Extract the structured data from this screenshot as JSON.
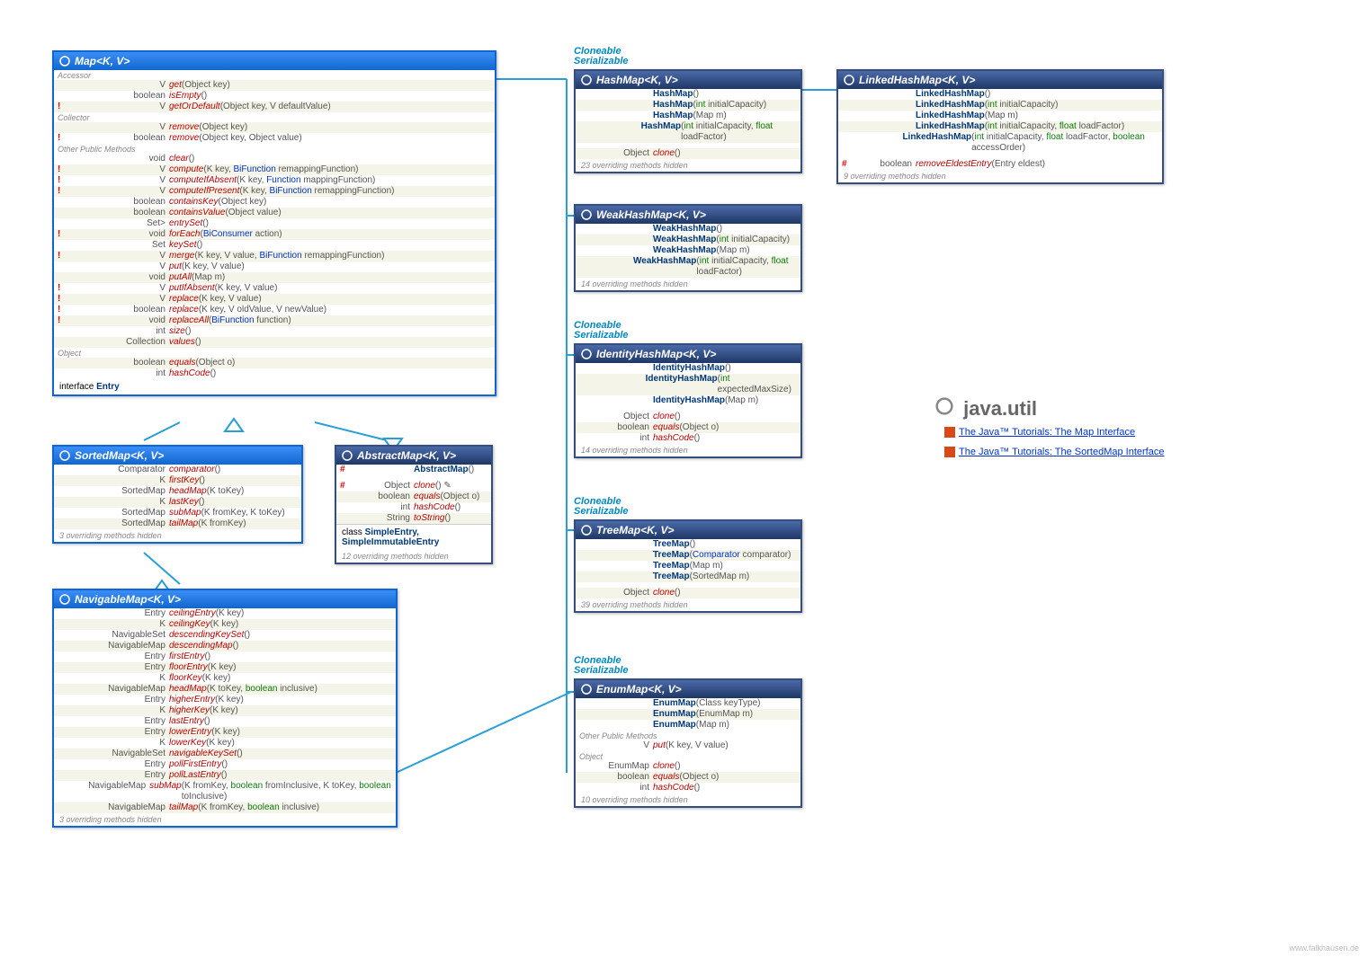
{
  "map": {
    "title": "Map<K, V>",
    "rows": [
      {
        "s": "Accessor"
      },
      {
        "r": "V",
        "n": "get",
        "a": "(Object key)"
      },
      {
        "r": "boolean",
        "n": "isEmpty",
        "a": "()"
      },
      {
        "m": "!",
        "r": "V",
        "n": "getOrDefault",
        "a": "(Object key, V defaultValue)"
      },
      {
        "s": "Collector"
      },
      {
        "r": "V",
        "n": "remove",
        "a": "(Object key)"
      },
      {
        "m": "!",
        "r": "boolean",
        "n": "remove",
        "a": "(Object key, Object value)"
      },
      {
        "s": "Other Public Methods"
      },
      {
        "r": "void",
        "n": "clear",
        "a": "()"
      },
      {
        "m": "!",
        "r": "V",
        "n": "compute",
        "a": "(K key, BiFunction<? super K, ? super V, ? extends V> remappingFunction)"
      },
      {
        "m": "!",
        "r": "V",
        "n": "computeIfAbsent",
        "a": "(K key, Function<? super K, ? extends V> mappingFunction)"
      },
      {
        "m": "!",
        "r": "V",
        "n": "computeIfPresent",
        "a": "(K key, BiFunction<? super K, ? super V, ? extends V> remappingFunction)"
      },
      {
        "r": "boolean",
        "n": "containsKey",
        "a": "(Object key)"
      },
      {
        "r": "boolean",
        "n": "containsValue",
        "a": "(Object value)"
      },
      {
        "r": "Set<Entry<K, V>>",
        "n": "entrySet",
        "a": "()"
      },
      {
        "m": "!",
        "r": "void",
        "n": "forEach",
        "a": "(BiConsumer<? super K, ? super V> action)"
      },
      {
        "r": "Set<K>",
        "n": "keySet",
        "a": "()"
      },
      {
        "m": "!",
        "r": "V",
        "n": "merge",
        "a": "(K key, V value, BiFunction<? super V, ? super V, ? extends V> remappingFunction)"
      },
      {
        "r": "V",
        "n": "put",
        "a": "(K key, V value)"
      },
      {
        "r": "void",
        "n": "putAll",
        "a": "(Map<? extends K, ? extends V> m)"
      },
      {
        "m": "!",
        "r": "V",
        "n": "putIfAbsent",
        "a": "(K key, V value)"
      },
      {
        "m": "!",
        "r": "V",
        "n": "replace",
        "a": "(K key, V value)"
      },
      {
        "m": "!",
        "r": "boolean",
        "n": "replace",
        "a": "(K key, V oldValue, V newValue)"
      },
      {
        "m": "!",
        "r": "void",
        "n": "replaceAll",
        "a": "(BiFunction<? super K, ? super V, ? extends V> function)"
      },
      {
        "r": "int",
        "n": "size",
        "a": "()"
      },
      {
        "r": "Collection<V>",
        "n": "values",
        "a": "()"
      },
      {
        "s": "Object"
      },
      {
        "r": "boolean",
        "n": "equals",
        "a": "(Object o)"
      },
      {
        "r": "int",
        "n": "hashCode",
        "a": "()"
      }
    ],
    "entry": "interface Entry"
  },
  "sortedmap": {
    "title": "SortedMap<K, V>",
    "rows": [
      {
        "r": "Comparator<? super K>",
        "n": "comparator",
        "a": "()"
      },
      {
        "r": "K",
        "n": "firstKey",
        "a": "()"
      },
      {
        "r": "SortedMap<K, V>",
        "n": "headMap",
        "a": "(K toKey)"
      },
      {
        "r": "K",
        "n": "lastKey",
        "a": "()"
      },
      {
        "r": "SortedMap<K, V>",
        "n": "subMap",
        "a": "(K fromKey, K toKey)"
      },
      {
        "r": "SortedMap<K, V>",
        "n": "tailMap",
        "a": "(K fromKey)"
      }
    ],
    "hidden": "3 overriding methods hidden"
  },
  "navmap": {
    "title": "NavigableMap<K, V>",
    "rows": [
      {
        "r": "Entry<K, V>",
        "n": "ceilingEntry",
        "a": "(K key)"
      },
      {
        "r": "K",
        "n": "ceilingKey",
        "a": "(K key)"
      },
      {
        "r": "NavigableSet<K>",
        "n": "descendingKeySet",
        "a": "()"
      },
      {
        "r": "NavigableMap<K, V>",
        "n": "descendingMap",
        "a": "()"
      },
      {
        "r": "Entry<K, V>",
        "n": "firstEntry",
        "a": "()"
      },
      {
        "r": "Entry<K, V>",
        "n": "floorEntry",
        "a": "(K key)"
      },
      {
        "r": "K",
        "n": "floorKey",
        "a": "(K key)"
      },
      {
        "r": "NavigableMap<K, V>",
        "n": "headMap",
        "a": "(K toKey, boolean inclusive)"
      },
      {
        "r": "Entry<K, V>",
        "n": "higherEntry",
        "a": "(K key)"
      },
      {
        "r": "K",
        "n": "higherKey",
        "a": "(K key)"
      },
      {
        "r": "Entry<K, V>",
        "n": "lastEntry",
        "a": "()"
      },
      {
        "r": "Entry<K, V>",
        "n": "lowerEntry",
        "a": "(K key)"
      },
      {
        "r": "K",
        "n": "lowerKey",
        "a": "(K key)"
      },
      {
        "r": "NavigableSet<K>",
        "n": "navigableKeySet",
        "a": "()"
      },
      {
        "r": "Entry<K, V>",
        "n": "pollFirstEntry",
        "a": "()"
      },
      {
        "r": "Entry<K, V>",
        "n": "pollLastEntry",
        "a": "()"
      },
      {
        "r": "NavigableMap<K, V>",
        "n": "subMap",
        "a": "(K fromKey, boolean fromInclusive, K toKey, boolean toInclusive)"
      },
      {
        "r": "NavigableMap<K, V>",
        "n": "tailMap",
        "a": "(K fromKey, boolean inclusive)"
      }
    ],
    "hidden": "3 overriding methods hidden"
  },
  "absmap": {
    "title": "AbstractMap<K, V>",
    "rows": [
      {
        "m": "#",
        "r": "",
        "n": "AbstractMap",
        "a": "()",
        "c": 1
      },
      {
        "sp": 1
      },
      {
        "m": "#",
        "r": "Object",
        "n": "clone",
        "a": "() ✎"
      },
      {
        "r": "boolean",
        "n": "equals",
        "a": "(Object o)"
      },
      {
        "r": "int",
        "n": "hashCode",
        "a": "()"
      },
      {
        "r": "String",
        "n": "toString",
        "a": "()"
      }
    ],
    "entry": "class SimpleEntry, SimpleImmutableEntry",
    "hidden": "12 overriding methods hidden"
  },
  "hashmap": {
    "title": "HashMap<K, V>",
    "rows": [
      {
        "r": "",
        "n": "HashMap",
        "a": "()",
        "c": 1
      },
      {
        "r": "",
        "n": "HashMap",
        "a": "(int initialCapacity)",
        "c": 1
      },
      {
        "r": "",
        "n": "HashMap",
        "a": "(Map<? extends K, ? extends V> m)",
        "c": 1
      },
      {
        "r": "",
        "n": "HashMap",
        "a": "(int initialCapacity, float loadFactor)",
        "c": 1
      },
      {
        "sp": 1
      },
      {
        "r": "Object",
        "n": "clone",
        "a": "()"
      }
    ],
    "hidden": "23 overriding methods hidden"
  },
  "weakmap": {
    "title": "WeakHashMap<K, V>",
    "rows": [
      {
        "r": "",
        "n": "WeakHashMap",
        "a": "()",
        "c": 1
      },
      {
        "r": "",
        "n": "WeakHashMap",
        "a": "(int initialCapacity)",
        "c": 1
      },
      {
        "r": "",
        "n": "WeakHashMap",
        "a": "(Map<? extends K, ? extends V> m)",
        "c": 1
      },
      {
        "r": "",
        "n": "WeakHashMap",
        "a": "(int initialCapacity, float loadFactor)",
        "c": 1
      }
    ],
    "hidden": "14 overriding methods hidden"
  },
  "idmap": {
    "title": "IdentityHashMap<K, V>",
    "rows": [
      {
        "r": "",
        "n": "IdentityHashMap",
        "a": "()",
        "c": 1
      },
      {
        "r": "",
        "n": "IdentityHashMap",
        "a": "(int expectedMaxSize)",
        "c": 1
      },
      {
        "r": "",
        "n": "IdentityHashMap",
        "a": "(Map<? extends K, ? extends V> m)",
        "c": 1
      },
      {
        "sp": 1
      },
      {
        "r": "Object",
        "n": "clone",
        "a": "()"
      },
      {
        "r": "boolean",
        "n": "equals",
        "a": "(Object o)"
      },
      {
        "r": "int",
        "n": "hashCode",
        "a": "()"
      }
    ],
    "hidden": "14 overriding methods hidden"
  },
  "treemap": {
    "title": "TreeMap<K, V>",
    "rows": [
      {
        "r": "",
        "n": "TreeMap",
        "a": "()",
        "c": 1
      },
      {
        "r": "",
        "n": "TreeMap",
        "a": "(Comparator<? super K> comparator)",
        "c": 1
      },
      {
        "r": "",
        "n": "TreeMap",
        "a": "(Map<? extends K, ? extends V> m)",
        "c": 1
      },
      {
        "r": "",
        "n": "TreeMap",
        "a": "(SortedMap<K, ? extends V> m)",
        "c": 1
      },
      {
        "sp": 1
      },
      {
        "r": "Object",
        "n": "clone",
        "a": "()"
      }
    ],
    "hidden": "39 overriding methods hidden"
  },
  "enummap": {
    "title": "EnumMap<K, V>",
    "rows": [
      {
        "r": "",
        "n": "EnumMap",
        "a": "(Class<K> keyType)",
        "c": 1
      },
      {
        "r": "",
        "n": "EnumMap",
        "a": "(EnumMap<K, ? extends V> m)",
        "c": 1
      },
      {
        "r": "",
        "n": "EnumMap",
        "a": "(Map<K, ? extends V> m)",
        "c": 1
      },
      {
        "s": "Other Public Methods"
      },
      {
        "r": "V",
        "n": "put",
        "a": "(K key, V value)"
      },
      {
        "s": "Object"
      },
      {
        "r": "EnumMap<K, V>",
        "n": "clone",
        "a": "()"
      },
      {
        "r": "boolean",
        "n": "equals",
        "a": "(Object o)"
      },
      {
        "r": "int",
        "n": "hashCode",
        "a": "()"
      }
    ],
    "hidden": "10 overriding methods hidden"
  },
  "linkedmap": {
    "title": "LinkedHashMap<K, V>",
    "rows": [
      {
        "r": "",
        "n": "LinkedHashMap",
        "a": "()",
        "c": 1
      },
      {
        "r": "",
        "n": "LinkedHashMap",
        "a": "(int initialCapacity)",
        "c": 1
      },
      {
        "r": "",
        "n": "LinkedHashMap",
        "a": "(Map<? extends K, ? extends V> m)",
        "c": 1
      },
      {
        "r": "",
        "n": "LinkedHashMap",
        "a": "(int initialCapacity, float loadFactor)",
        "c": 1
      },
      {
        "r": "",
        "n": "LinkedHashMap",
        "a": "(int initialCapacity, float loadFactor, boolean accessOrder)",
        "c": 1
      },
      {
        "sp": 1
      },
      {
        "m": "#",
        "r": "boolean",
        "n": "removeEldestEntry",
        "a": "(Entry<K, V> eldest)"
      }
    ],
    "hidden": "9 overriding methods hidden"
  },
  "pkg": "java.util",
  "links": [
    "The Java™ Tutorials: The Map Interface",
    "The Java™ Tutorials: The SortedMap Interface"
  ],
  "stereo": "Cloneable\nSerializable",
  "footer": "www.falkhausen.de"
}
